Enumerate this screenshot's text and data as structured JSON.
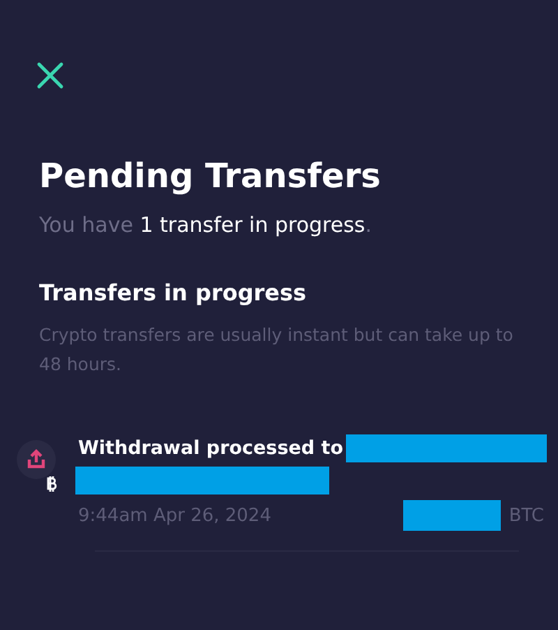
{
  "title": "Pending Transfers",
  "summary": "You have **1 transfer in progress**.",
  "section": {
    "heading": "Transfers in progress",
    "description": "Crypto transfers are usually instant but can take up to 48 hours."
  },
  "transfers": [
    {
      "kind": "withdrawal",
      "title": "Withdrawal processed to",
      "time": "9:44am Apr 26, 2024",
      "currency": "BTC"
    }
  ]
}
